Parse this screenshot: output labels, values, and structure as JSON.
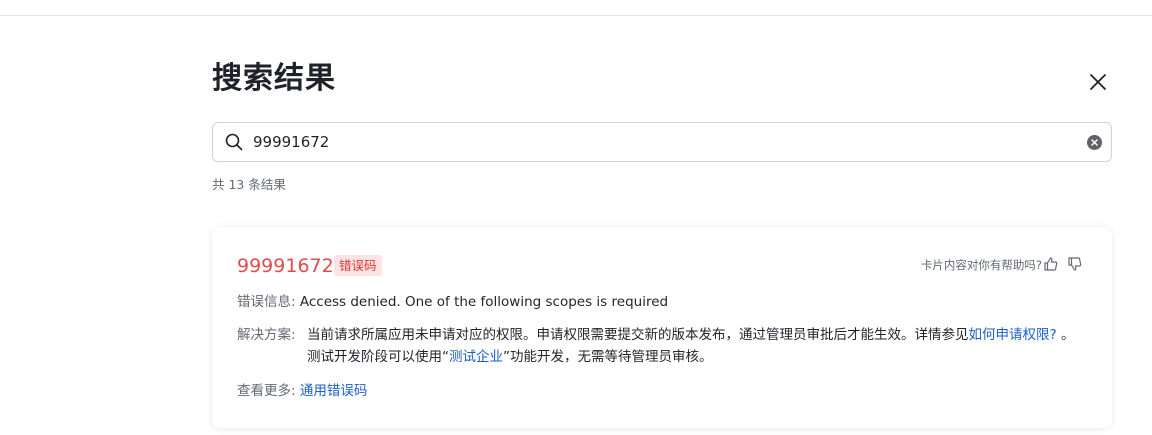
{
  "header": {
    "title": "搜索结果"
  },
  "search": {
    "value": "99991672"
  },
  "results": {
    "count_text": "共 13 条结果"
  },
  "card": {
    "code": "99991672",
    "badge": "错误码",
    "helpful_prompt": "卡片内容对你有帮助吗?",
    "info_label": "错误信息:",
    "info_text": "Access denied. One of the following scopes is required",
    "solution_label": "解决方案:",
    "solution_text_1": "当前请求所属应用未申请对应的权限。申请权限需要提交新的版本发布，通过管理员审批后才能生效。详情参见",
    "solution_link_1": "如何申请权限?",
    "solution_text_2": " 。测试开发阶段可以使用“",
    "solution_link_2": "测试企业",
    "solution_text_3": "”功能开发，无需等待管理员审核。",
    "more_label": "查看更多:",
    "more_link": "通用错误码"
  },
  "colors": {
    "accent_red": "#e04b4b",
    "badge_bg": "#fde3e3",
    "link_blue": "#1e5fcc"
  },
  "icons": {
    "search": "search-icon",
    "close": "close-icon",
    "clear": "clear-icon",
    "thumbs_up": "thumbs-up-icon",
    "thumbs_down": "thumbs-down-icon"
  }
}
